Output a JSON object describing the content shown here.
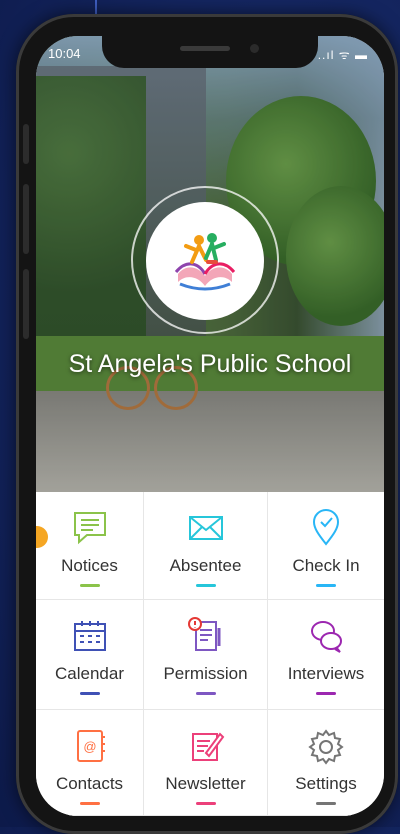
{
  "status": {
    "time": "10:04",
    "icons": "..ıl ᯤ ▬"
  },
  "school": {
    "name": "St Angela's Public School"
  },
  "menu": [
    {
      "id": "notices",
      "label": "Notices",
      "icon": "speech-bubble-icon",
      "color": "#8bc34a"
    },
    {
      "id": "absentee",
      "label": "Absentee",
      "icon": "envelope-icon",
      "color": "#26c6da"
    },
    {
      "id": "checkin",
      "label": "Check In",
      "icon": "location-pin-icon",
      "color": "#29b6f6"
    },
    {
      "id": "calendar",
      "label": "Calendar",
      "icon": "calendar-icon",
      "color": "#3f51b5"
    },
    {
      "id": "permission",
      "label": "Permission",
      "icon": "permission-form-icon",
      "color": "#7e57c2"
    },
    {
      "id": "interviews",
      "label": "Interviews",
      "icon": "chat-bubbles-icon",
      "color": "#9c27b0"
    },
    {
      "id": "contacts",
      "label": "Contacts",
      "icon": "address-book-icon",
      "color": "#ff7043"
    },
    {
      "id": "newsletter",
      "label": "Newsletter",
      "icon": "newsletter-icon",
      "color": "#ec407a"
    },
    {
      "id": "settings",
      "label": "Settings",
      "icon": "gear-icon",
      "color": "#757575"
    }
  ]
}
